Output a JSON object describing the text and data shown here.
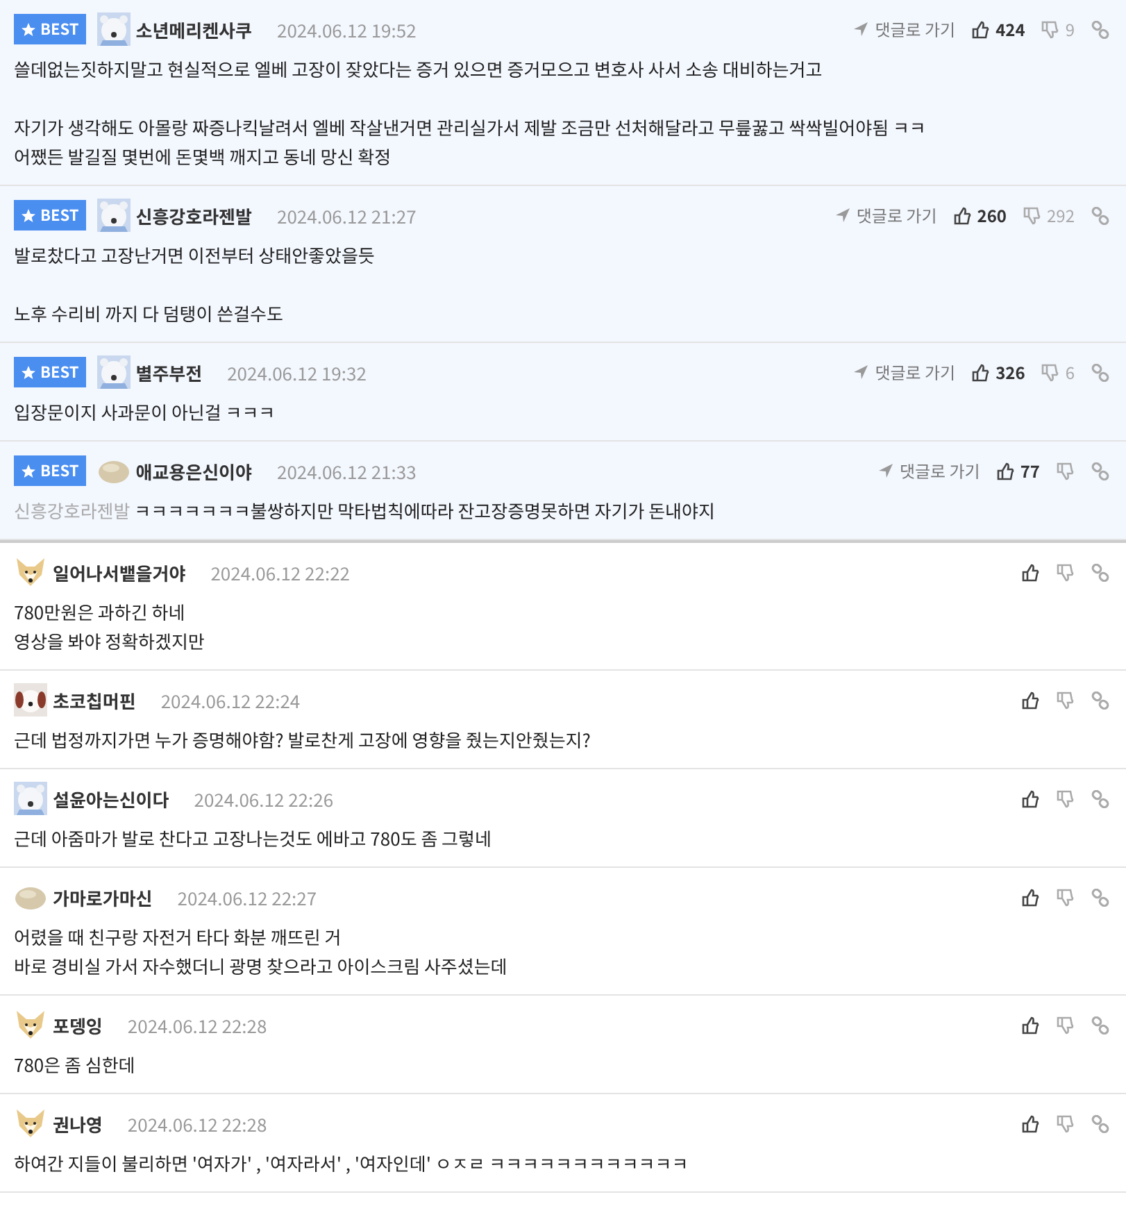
{
  "comments": [
    {
      "best": true,
      "badge": "BEST",
      "avatar": {
        "kind": "bear"
      },
      "author": "소년메리켄사쿠",
      "time": "2024.06.12 19:52",
      "goto": "댓글로 가기",
      "likes": "424",
      "dislikes": "9",
      "paragraphs": [
        "쓸데없는짓하지말고 현실적으로 엘베 고장이 잦았다는 증거 있으면 증거모으고 변호사 사서 소송 대비하는거고",
        "자기가 생각해도 아몰랑 짜증나킥날려서 엘베 작살낸거면 관리실가서 제발 조금만 선처해달라고 무릎꿇고 싹싹빌어야됨 ㅋㅋ\n어쨌든 발길질 몇번에 돈몇백 깨지고 동네 망신 확정"
      ]
    },
    {
      "best": true,
      "badge": "BEST",
      "avatar": {
        "kind": "bear"
      },
      "author": "신흥강호라젠발",
      "time": "2024.06.12 21:27",
      "goto": "댓글로 가기",
      "likes": "260",
      "dislikes": "292",
      "paragraphs": [
        "발로찼다고 고장난거면 이전부터 상태안좋았을듯",
        "노후 수리비 까지 다 덤탱이 쓴걸수도"
      ]
    },
    {
      "best": true,
      "badge": "BEST",
      "avatar": {
        "kind": "bear"
      },
      "author": "별주부전",
      "time": "2024.06.12 19:32",
      "goto": "댓글로 가기",
      "likes": "326",
      "dislikes": "6",
      "paragraphs": [
        "입장문이지 사과문이 아닌걸 ㅋㅋㅋ"
      ]
    },
    {
      "best": true,
      "badge": "BEST",
      "avatar": {
        "kind": "blob"
      },
      "author": "애교용은신이야",
      "time": "2024.06.12 21:33",
      "goto": "댓글로 가기",
      "likes": "77",
      "mention": "신흥강호라젠발",
      "paragraphs": [
        "ㅋㅋㅋㅋㅋㅋㅋ불쌍하지만 막타법칙에따라 잔고장증명못하면 자기가 돈내야지"
      ]
    },
    {
      "best": false,
      "avatar": {
        "kind": "fox"
      },
      "author": "일어나서뱉을거야",
      "time": "2024.06.12 22:22",
      "paragraphs": [
        "780만원은 과하긴 하네\n영상을 봐야 정확하겠지만"
      ]
    },
    {
      "best": false,
      "avatar": {
        "kind": "puppy"
      },
      "author": "초코칩머핀",
      "time": "2024.06.12 22:24",
      "paragraphs": [
        "근데 법정까지가면 누가 증명해야함? 발로찬게 고장에 영향을 줬는지안줬는지?"
      ]
    },
    {
      "best": false,
      "avatar": {
        "kind": "bear"
      },
      "author": "설윤아는신이다",
      "time": "2024.06.12 22:26",
      "paragraphs": [
        "근데 아줌마가 발로 찬다고 고장나는것도 에바고 780도 좀 그렇네"
      ]
    },
    {
      "best": false,
      "avatar": {
        "kind": "blob"
      },
      "author": "가마로가마신",
      "time": "2024.06.12 22:27",
      "paragraphs": [
        "어렸을 때 친구랑 자전거 타다 화분 깨뜨린 거\n바로 경비실 가서 자수했더니 광명 찾으라고 아이스크림 사주셨는데"
      ]
    },
    {
      "best": false,
      "avatar": {
        "kind": "fox"
      },
      "author": "포뎅잉",
      "time": "2024.06.12 22:28",
      "paragraphs": [
        "780은 좀 심한데"
      ]
    },
    {
      "best": false,
      "avatar": {
        "kind": "fox"
      },
      "author": "권나영",
      "time": "2024.06.12 22:28",
      "paragraphs": [
        "하여간 지들이 불리하면 '여자가' , '여자라서' , '여자인데' ㅇㅈㄹ ㅋㅋㅋㅋㅋㅋㅋㅋㅋㅋㅋㅋ"
      ]
    }
  ]
}
